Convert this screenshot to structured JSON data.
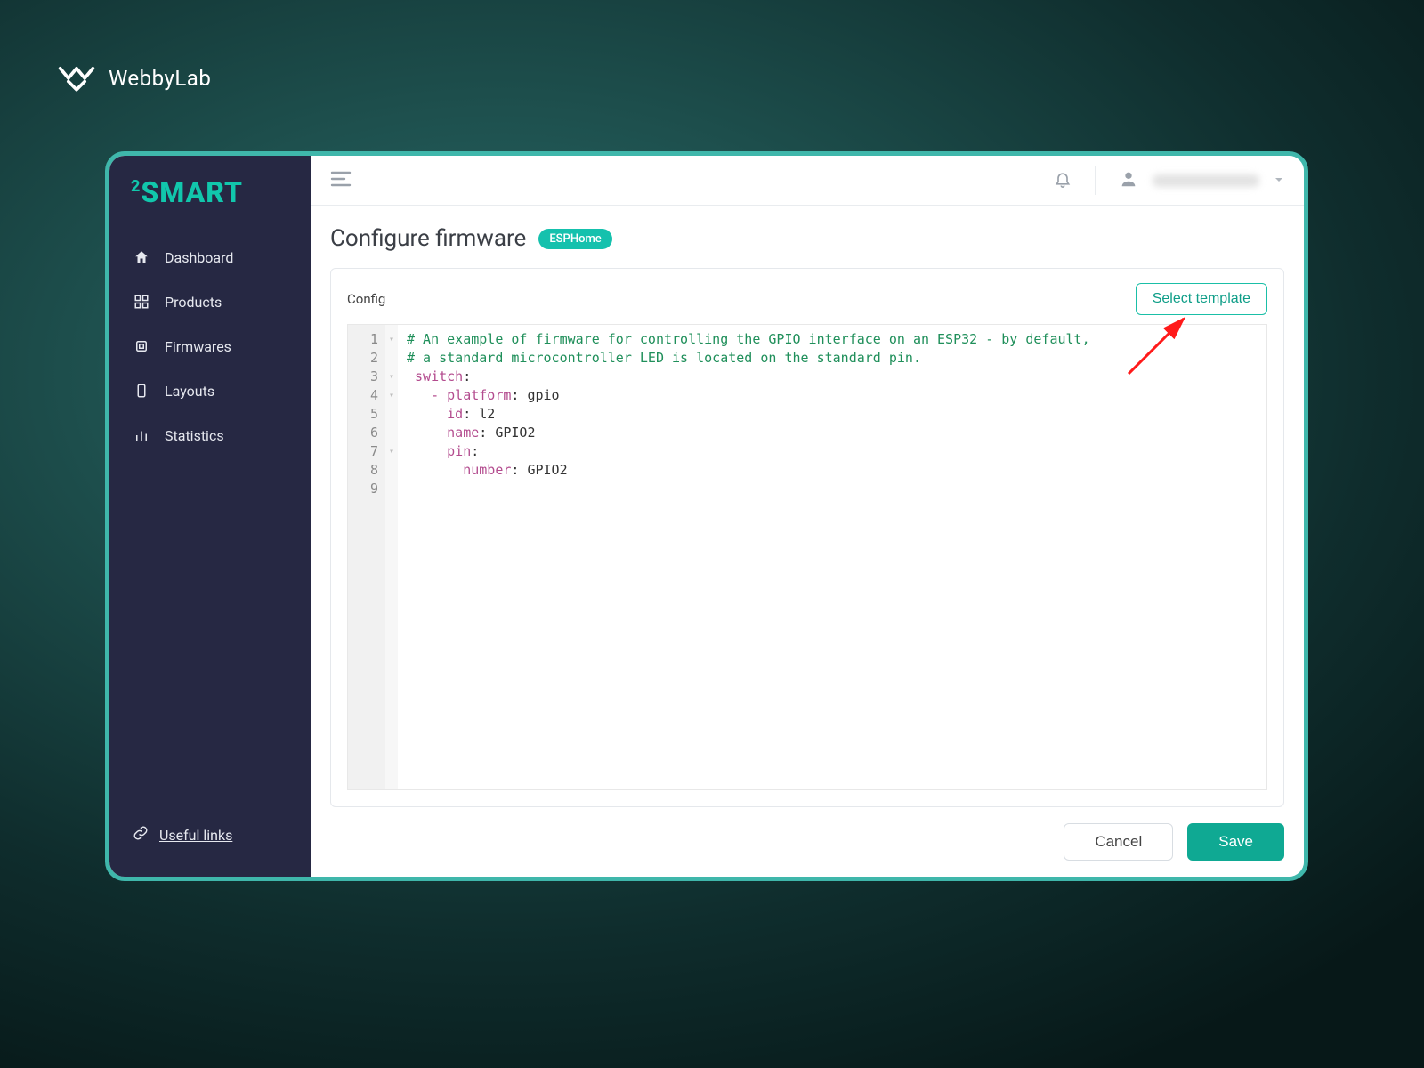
{
  "brand": {
    "name": "WebbyLab"
  },
  "app_logo": "SMART",
  "app_logo_prefix": "2",
  "sidebar": {
    "items": [
      {
        "label": "Dashboard"
      },
      {
        "label": "Products"
      },
      {
        "label": "Firmwares"
      },
      {
        "label": "Layouts"
      },
      {
        "label": "Statistics"
      }
    ],
    "useful_links": "Useful links"
  },
  "page": {
    "title": "Configure firmware",
    "badge": "ESPHome"
  },
  "config": {
    "label": "Config",
    "select_template": "Select template",
    "code_lines": [
      {
        "n": "1",
        "fold": true,
        "text": "# An example of firmware for controlling the GPIO interface on an ESP32 - by default,",
        "cls": "c-comment"
      },
      {
        "n": "2",
        "fold": false,
        "text": "# a standard microcontroller LED is located on the standard pin.",
        "cls": "c-comment"
      },
      {
        "n": "3",
        "fold": true,
        "key": " switch",
        "val": ":"
      },
      {
        "n": "4",
        "fold": true,
        "key": "   - platform",
        "val": ": gpio"
      },
      {
        "n": "5",
        "fold": false,
        "key": "     id",
        "val": ": l2"
      },
      {
        "n": "6",
        "fold": false,
        "key": "     name",
        "val": ": GPIO2"
      },
      {
        "n": "7",
        "fold": true,
        "key": "     pin",
        "val": ":"
      },
      {
        "n": "8",
        "fold": false,
        "key": "       number",
        "val": ": GPIO2"
      },
      {
        "n": "9",
        "fold": false,
        "text": ""
      }
    ]
  },
  "buttons": {
    "cancel": "Cancel",
    "save": "Save"
  }
}
